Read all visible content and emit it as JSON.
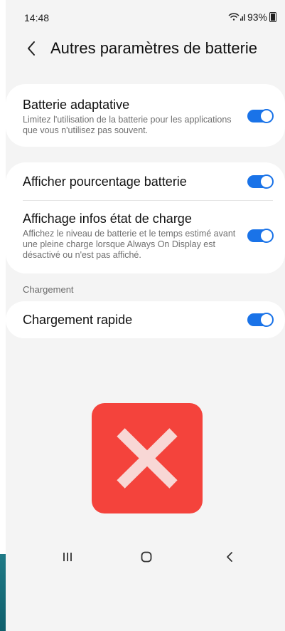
{
  "status": {
    "time": "14:48",
    "battery": "93%"
  },
  "header": {
    "title": "Autres paramètres de batterie"
  },
  "settings": [
    {
      "title": "Batterie adaptative",
      "description": "Limitez l'utilisation de la batterie pour les applications que vous n'utilisez pas souvent.",
      "enabled": true
    },
    {
      "title": "Afficher pourcentage batterie",
      "description": "",
      "enabled": true
    },
    {
      "title": "Affichage infos état de charge",
      "description": "Affichez le niveau de batterie et le temps estimé avant une pleine charge lorsque Always On Display est désactivé ou n'est pas affiché.",
      "enabled": true
    },
    {
      "title": "Chargement rapide",
      "description": "",
      "enabled": true
    }
  ],
  "sections": {
    "chargement": "Chargement"
  },
  "overlay": {
    "icon": "close-icon",
    "color": "#f4433c"
  },
  "navigation": {
    "recents_icon": "recents-icon",
    "home_icon": "home-icon",
    "back_icon": "back-icon"
  },
  "colors": {
    "accent": "#1a73e8",
    "error": "#f4433c"
  }
}
